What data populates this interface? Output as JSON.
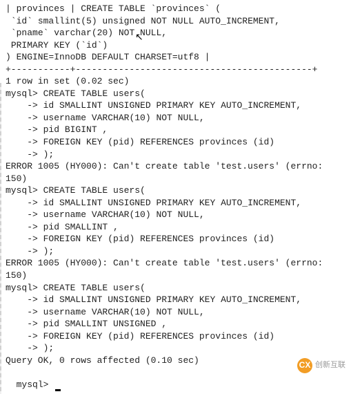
{
  "terminal": {
    "lines": [
      "| provinces | CREATE TABLE `provinces` (",
      " `id` smallint(5) unsigned NOT NULL AUTO_INCREMENT,",
      " `pname` varchar(20) NOT NULL,",
      " PRIMARY KEY (`id`)",
      ") ENGINE=InnoDB DEFAULT CHARSET=utf8 |",
      "+-----------+--------------------------------------------+",
      "1 row in set (0.02 sec)",
      "",
      "mysql> CREATE TABLE users(",
      "    -> id SMALLINT UNSIGNED PRIMARY KEY AUTO_INCREMENT,",
      "    -> username VARCHAR(10) NOT NULL,",
      "    -> pid BIGINT ,",
      "    -> FOREIGN KEY (pid) REFERENCES provinces (id)",
      "    -> );",
      "ERROR 1005 (HY000): Can't create table 'test.users' (errno: 150)",
      "mysql> CREATE TABLE users(",
      "    -> id SMALLINT UNSIGNED PRIMARY KEY AUTO_INCREMENT,",
      "    -> username VARCHAR(10) NOT NULL,",
      "    -> pid SMALLINT ,",
      "    -> FOREIGN KEY (pid) REFERENCES provinces (id)",
      "    -> );",
      "ERROR 1005 (HY000): Can't create table 'test.users' (errno: 150)",
      "mysql> CREATE TABLE users(",
      "    -> id SMALLINT UNSIGNED PRIMARY KEY AUTO_INCREMENT,",
      "    -> username VARCHAR(10) NOT NULL,",
      "    -> pid SMALLINT UNSIGNED ,",
      "    -> FOREIGN KEY (pid) REFERENCES provinces (id)",
      "    -> );",
      "Query OK, 0 rows affected (0.10 sec)",
      "",
      "mysql> "
    ]
  },
  "watermark": {
    "badge": "CX",
    "text": "创新互联"
  }
}
